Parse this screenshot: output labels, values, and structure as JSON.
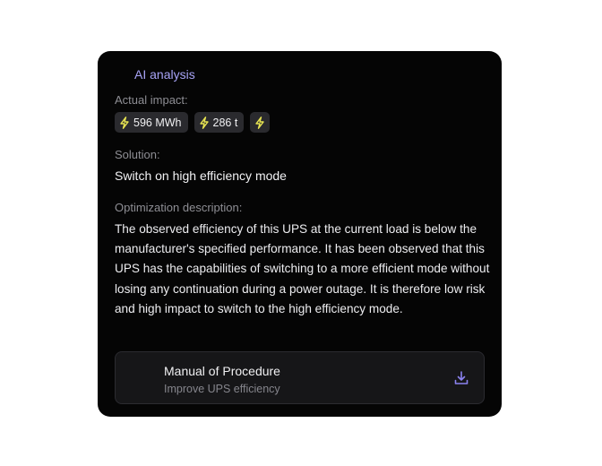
{
  "header": {
    "title": "AI analysis"
  },
  "impact": {
    "label": "Actual impact:",
    "chips": [
      {
        "value": "596 MWh",
        "icon": "lightning-bolt-icon"
      },
      {
        "value": "286 t",
        "icon": "lightning-bolt-icon"
      },
      {
        "value": "",
        "icon": "lightning-bolt-icon"
      }
    ]
  },
  "solution": {
    "label": "Solution:",
    "text": "Switch on high efficiency mode"
  },
  "optimization": {
    "label": "Optimization description:",
    "text": "The observed efficiency of this UPS at the current load is below the manufacturer's specified performance. It has been observed that this UPS has the capabilities of switching to a more efficient mode without losing any continuation during a power outage. It is therefore low risk and high impact to switch to the high efficiency mode."
  },
  "manual": {
    "title": "Manual of Procedure",
    "subtitle": "Improve UPS efficiency",
    "icon": "download-icon"
  },
  "colors": {
    "card_bg": "#050505",
    "accent": "#a7a3f5",
    "bolt": "#e8e552",
    "download": "#8b82f0"
  }
}
